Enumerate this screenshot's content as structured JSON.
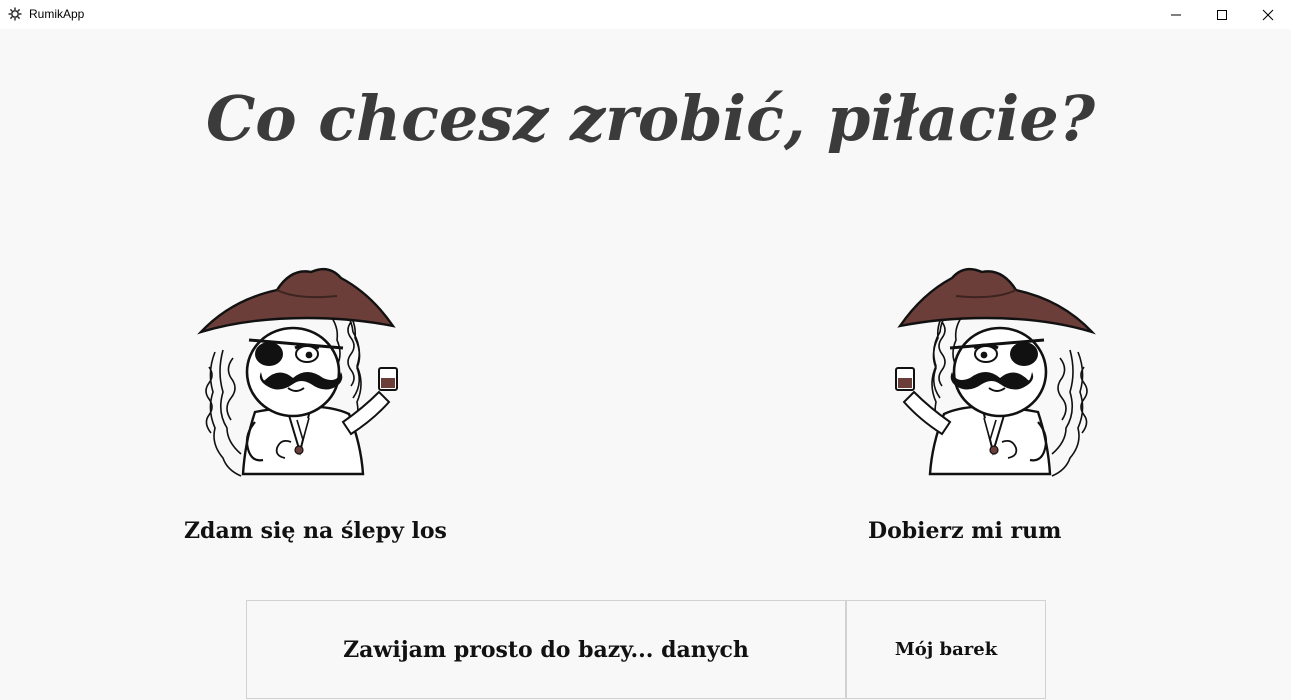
{
  "window": {
    "title": "RumikApp",
    "app_icon": "gear-icon",
    "controls": [
      "minimize-icon",
      "maximize-icon",
      "close-icon"
    ]
  },
  "main": {
    "headline": "Co chcesz zrobić, piłacie?",
    "choices": [
      {
        "label": "Zdam się na ślepy los",
        "image": "pirate-illustration"
      },
      {
        "label": "Dobierz mi rum",
        "image": "pirate-illustration"
      }
    ],
    "buttons": {
      "database": "Zawijam prosto do bazy... danych",
      "my_bar": "Mój barek"
    }
  },
  "colors": {
    "background": "#f8f8f8",
    "headline": "#3b3b3b",
    "hat": "#6b3e39"
  }
}
